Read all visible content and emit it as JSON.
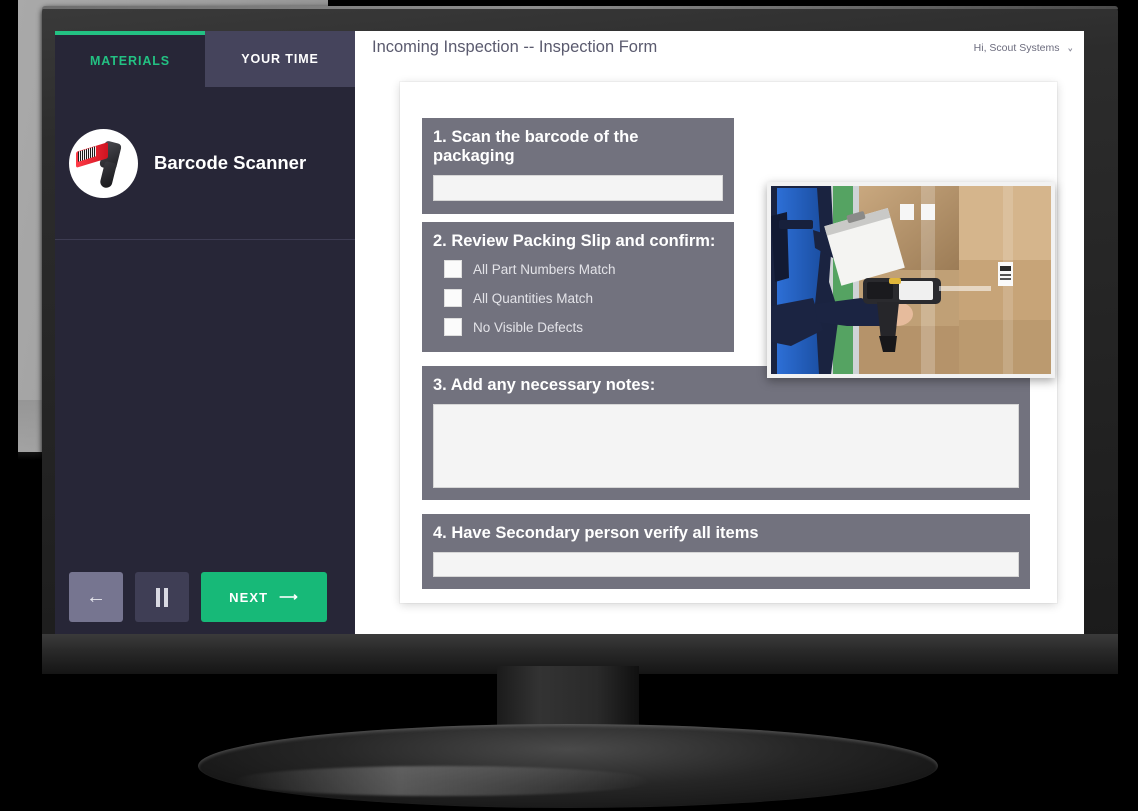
{
  "app": {
    "accent_green": "#23c183",
    "sidebar_bg": "#272637",
    "step_bg": "#72727e",
    "next_button_bg": "#17b978"
  },
  "sidebar": {
    "tabs": [
      {
        "label": "MATERIALS",
        "active": true
      },
      {
        "label": "YOUR TIME",
        "active": false
      }
    ],
    "material": {
      "name": "Barcode Scanner",
      "icon": "barcode-scanner-icon"
    },
    "controls": {
      "back_label": "←",
      "pause_label": "II",
      "next_label": "NEXT",
      "next_arrow": "⟶"
    }
  },
  "header": {
    "title": "Incoming Inspection -- Inspection Form",
    "user_greeting": "Hi, Scout Systems",
    "chevron": "⌄"
  },
  "form": {
    "steps": [
      {
        "title": "1. Scan the barcode of the packaging",
        "type": "text-input",
        "value": "",
        "placeholder": ""
      },
      {
        "title": "2. Review Packing Slip and confirm:",
        "type": "checkbox-group",
        "options": [
          {
            "label": "All Part Numbers Match",
            "checked": false
          },
          {
            "label": "All Quantities Match",
            "checked": false
          },
          {
            "label": "No Visible Defects",
            "checked": false
          }
        ]
      },
      {
        "title": "3. Add any necessary notes:",
        "type": "textarea",
        "value": "",
        "placeholder": ""
      },
      {
        "title": "4. Have Secondary person verify all items",
        "type": "text-input",
        "value": "",
        "placeholder": ""
      }
    ],
    "photo": {
      "name": "warehouse-worker-scanning-boxes-photo",
      "alt": "Worker in blue vest holding a clipboard and barcode scanner in front of stacked cardboard boxes"
    }
  }
}
